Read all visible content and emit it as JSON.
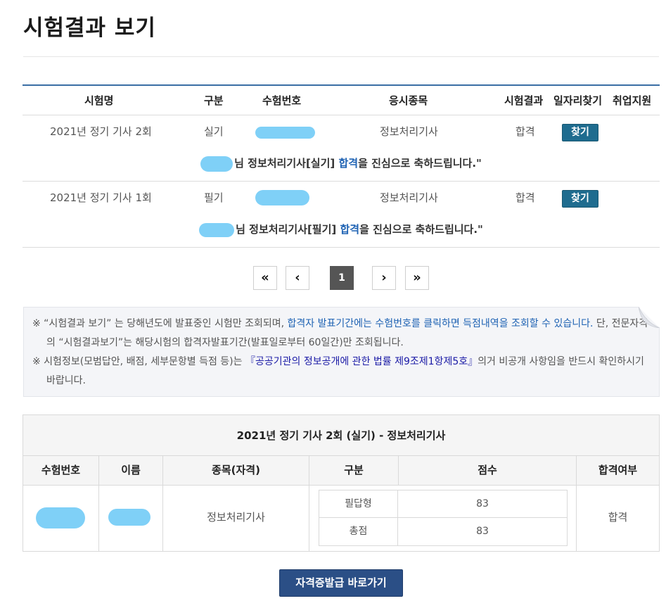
{
  "page": {
    "title": "시험결과 보기"
  },
  "results_table": {
    "headers": [
      "시험명",
      "구분",
      "수험번호",
      "응시종목",
      "시험결과",
      "일자리찾기",
      "취업지원"
    ],
    "rows": [
      {
        "exam_name": "2021년 정기 기사 2회",
        "type": "실기",
        "subject": "정보처리기사",
        "result": "합격",
        "find_label": "찾기",
        "message_mid": "님 정보처리기사[실기] ",
        "message_hl": "합격",
        "message_end": "을 진심으로 축하드립니다.\""
      },
      {
        "exam_name": "2021년 정기 기사 1회",
        "type": "필기",
        "subject": "정보처리기사",
        "result": "합격",
        "find_label": "찾기",
        "message_mid": "님 정보처리기사[필기] ",
        "message_hl": "합격",
        "message_end": "을 진심으로 축하드립니다.\""
      }
    ]
  },
  "pagination": {
    "first": "«",
    "prev": "‹",
    "current": "1",
    "next": "›",
    "last": "»"
  },
  "notice": {
    "line1_a": "※ “시험결과 보기” 는 당해년도에 발표중인 시험만 조회되며, ",
    "line1_hl": "합격자 발표기간에는 수험번호를 클릭하면 득점내역을 조회할 수 있습니다.",
    "line1_b": " 단, 전문자격의 “시험결과보기”는 해당시험의 합격자발표기간(발표일로부터 60일간)만 조회됩니다.",
    "line2_a": "※ 시험정보(모범답안, 배점, 세부문항별 득점 등)는 ",
    "line2_law": "『공공기관의 정보공개에 관한 법률 제9조제1항제5호』",
    "line2_b": "의거 비공개 사항임을 반드시 확인하시기 바랍니다."
  },
  "detail": {
    "title": "2021년 정기 기사 2회 (실기) - 정보처리기사",
    "headers": [
      "수험번호",
      "이름",
      "종목(자격)",
      "구분",
      "점수",
      "합격여부"
    ],
    "subject": "정보처리기사",
    "scores": [
      {
        "label": "필답형",
        "value": "83"
      },
      {
        "label": "총점",
        "value": "83"
      }
    ],
    "pass_status": "합격"
  },
  "issue_button": {
    "label": "자격증발급 바로가기"
  },
  "colors": {
    "accent": "#3a6ea5",
    "button": "#1f6c8f",
    "issue_button": "#2b4f86",
    "highlight": "#1e62b3",
    "redaction": "#7fd0f7"
  }
}
